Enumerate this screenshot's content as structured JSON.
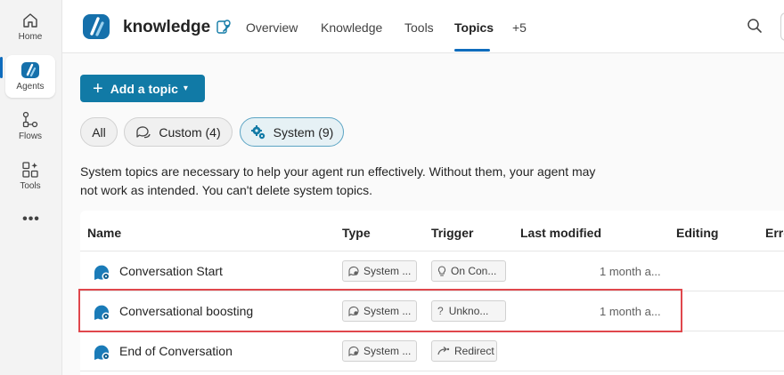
{
  "rail": {
    "items": [
      {
        "label": "Home",
        "icon": "home-icon"
      },
      {
        "label": "Agents",
        "icon": "agents-icon",
        "active": true
      },
      {
        "label": "Flows",
        "icon": "flows-icon"
      },
      {
        "label": "Tools",
        "icon": "tools-icon"
      }
    ],
    "more": "•••"
  },
  "header": {
    "agent_name": "knowledge",
    "tabs": [
      {
        "label": "Overview"
      },
      {
        "label": "Knowledge"
      },
      {
        "label": "Tools"
      },
      {
        "label": "Topics",
        "active": true
      },
      {
        "label": "+5"
      }
    ]
  },
  "toolbar": {
    "add_topic_label": "Add a topic"
  },
  "filters": [
    {
      "label": "All"
    },
    {
      "label": "Custom (4)"
    },
    {
      "label": "System (9)",
      "active": true
    }
  ],
  "description": "System topics are necessary to help your agent run effectively. Without them, your agent may not work as intended. You can't delete system topics.",
  "table": {
    "columns": [
      "Name",
      "Type",
      "Trigger",
      "Last modified",
      "Editing",
      "Erro"
    ],
    "rows": [
      {
        "name": "Conversation Start",
        "type": "System ...",
        "trigger": "On Con...",
        "trigger_icon": "lightbulb-icon",
        "modified": "1 month a..."
      },
      {
        "name": "Conversational boosting",
        "type": "System ...",
        "trigger": "Unkno...",
        "trigger_icon": "question-icon",
        "modified": "1 month a...",
        "highlighted": true
      },
      {
        "name": "End of Conversation",
        "type": "System ...",
        "trigger": "Redirect",
        "trigger_icon": "redirect-icon",
        "modified": ""
      }
    ]
  },
  "colors": {
    "brand_blue": "#117aa6",
    "accent": "#0f6cbd",
    "highlight_red": "#e0474c"
  }
}
